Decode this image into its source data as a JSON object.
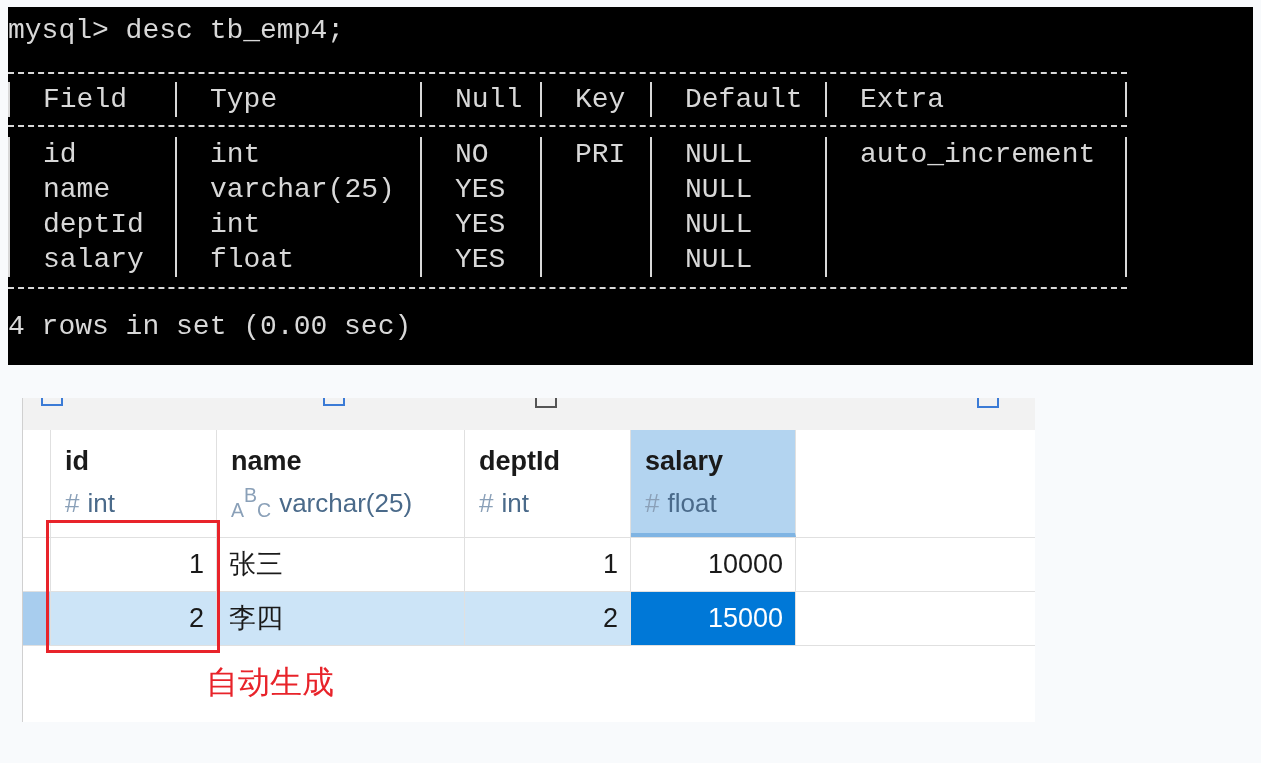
{
  "terminal": {
    "command": "mysql> desc tb_emp4;",
    "columns": [
      "Field",
      "Type",
      "Null",
      "Key",
      "Default",
      "Extra"
    ],
    "rows": [
      [
        "id",
        "int",
        "NO",
        "PRI",
        "NULL",
        "auto_increment"
      ],
      [
        "name",
        "varchar(25)",
        "YES",
        "",
        "NULL",
        ""
      ],
      [
        "deptId",
        "int",
        "YES",
        "",
        "NULL",
        ""
      ],
      [
        "salary",
        "float",
        "YES",
        "",
        "NULL",
        ""
      ]
    ],
    "footer": "4 rows in set (0.00 sec)"
  },
  "grid": {
    "columns": [
      {
        "name": "id",
        "type_icon": "#",
        "type": "int",
        "selected": false
      },
      {
        "name": "name",
        "type_icon": "$_{A}$$^{B}$$_{C}$",
        "type": "varchar(25)",
        "selected": false
      },
      {
        "name": "deptId",
        "type_icon": "#",
        "type": "int",
        "selected": false
      },
      {
        "name": "salary",
        "type_icon": "#",
        "type": "float",
        "selected": true
      }
    ],
    "rows": [
      {
        "selected": false,
        "cells": [
          {
            "value": "1",
            "selected": false
          },
          {
            "value": "张三",
            "selected": false
          },
          {
            "value": "1",
            "selected": false
          },
          {
            "value": "10000",
            "selected": false
          }
        ]
      },
      {
        "selected": true,
        "cells": [
          {
            "value": "2",
            "selected": false
          },
          {
            "value": "李四",
            "selected": false
          },
          {
            "value": "2",
            "selected": false
          },
          {
            "value": "15000",
            "selected": true
          }
        ]
      }
    ]
  },
  "annotation": {
    "text": "自动生成"
  }
}
